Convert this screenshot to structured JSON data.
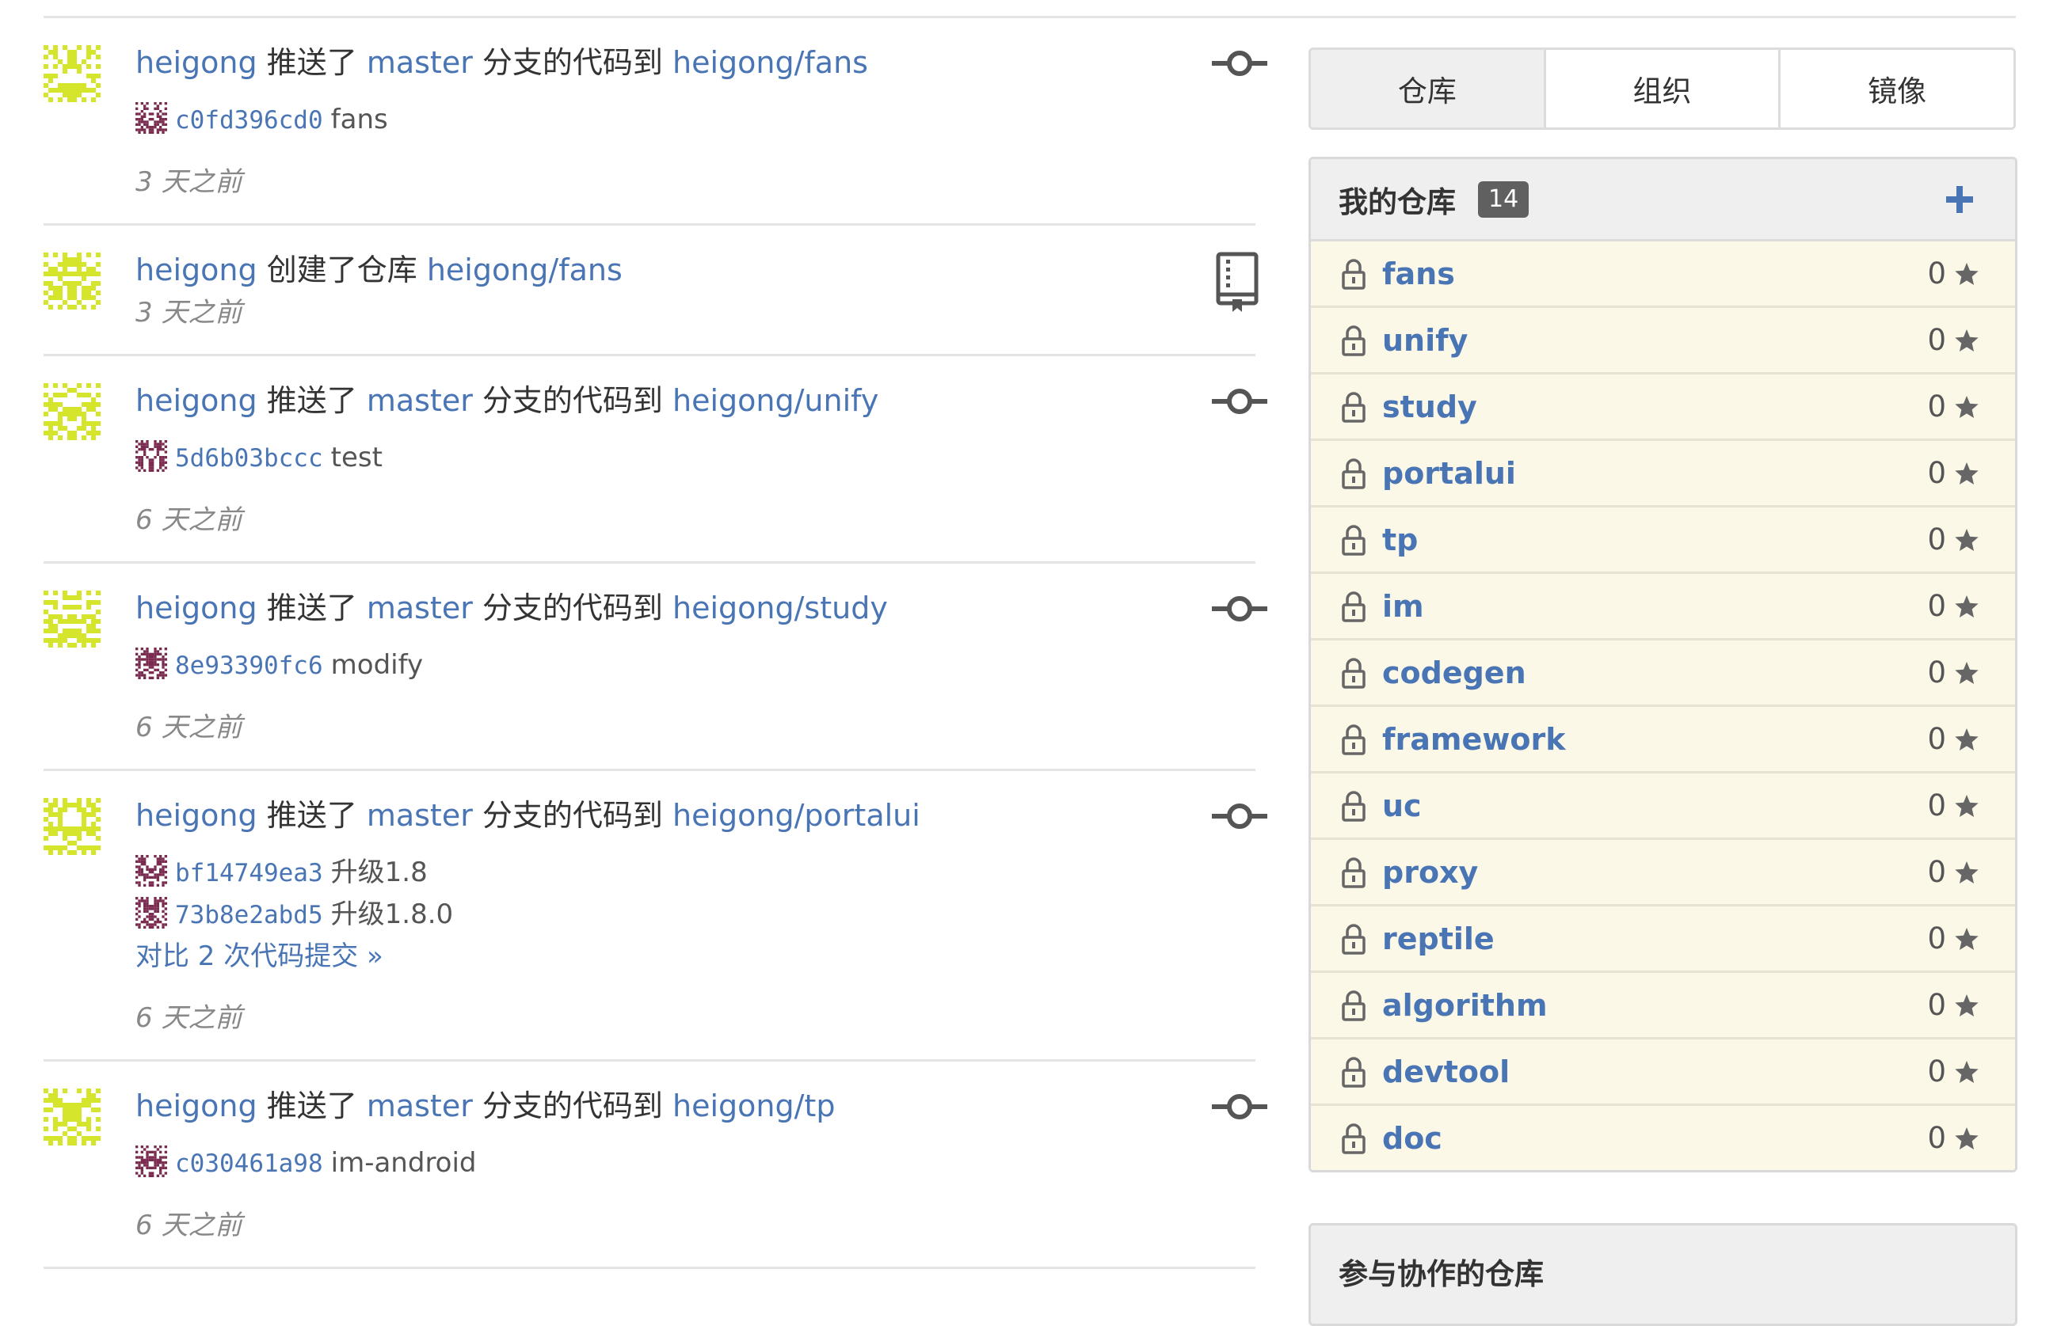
{
  "feed": [
    {
      "user": "heigong",
      "action": "推送了",
      "branch": "master",
      "mid": "分支的代码到",
      "repo": "heigong/fans",
      "icon": "commit-icon",
      "commits": [
        {
          "sha": "c0fd396cd0",
          "message": "fans"
        }
      ],
      "compare": "",
      "time": "3 天之前"
    },
    {
      "user": "heigong",
      "action": "创建了仓库",
      "branch": "",
      "mid": "",
      "repo": "heigong/fans",
      "icon": "repo-book-icon",
      "commits": [],
      "compare": "",
      "time": "3 天之前"
    },
    {
      "user": "heigong",
      "action": "推送了",
      "branch": "master",
      "mid": "分支的代码到",
      "repo": "heigong/unify",
      "icon": "commit-icon",
      "commits": [
        {
          "sha": "5d6b03bccc",
          "message": "test"
        }
      ],
      "compare": "",
      "time": "6 天之前"
    },
    {
      "user": "heigong",
      "action": "推送了",
      "branch": "master",
      "mid": "分支的代码到",
      "repo": "heigong/study",
      "icon": "commit-icon",
      "commits": [
        {
          "sha": "8e93390fc6",
          "message": "modify"
        }
      ],
      "compare": "",
      "time": "6 天之前"
    },
    {
      "user": "heigong",
      "action": "推送了",
      "branch": "master",
      "mid": "分支的代码到",
      "repo": "heigong/portalui",
      "icon": "commit-icon",
      "commits": [
        {
          "sha": "bf14749ea3",
          "message": "升级1.8"
        },
        {
          "sha": "73b8e2abd5",
          "message": "升级1.8.0"
        }
      ],
      "compare": "对比 2 次代码提交 »",
      "time": "6 天之前"
    },
    {
      "user": "heigong",
      "action": "推送了",
      "branch": "master",
      "mid": "分支的代码到",
      "repo": "heigong/tp",
      "icon": "commit-icon",
      "commits": [
        {
          "sha": "c030461a98",
          "message": "im-android"
        }
      ],
      "compare": "",
      "time": "6 天之前"
    }
  ],
  "tabs": [
    "仓库",
    "组织",
    "镜像"
  ],
  "my_repos": {
    "title": "我的仓库",
    "count": "14",
    "add_icon": "plus-icon",
    "items": [
      {
        "name": "fans",
        "stars": "0"
      },
      {
        "name": "unify",
        "stars": "0"
      },
      {
        "name": "study",
        "stars": "0"
      },
      {
        "name": "portalui",
        "stars": "0"
      },
      {
        "name": "tp",
        "stars": "0"
      },
      {
        "name": "im",
        "stars": "0"
      },
      {
        "name": "codegen",
        "stars": "0"
      },
      {
        "name": "framework",
        "stars": "0"
      },
      {
        "name": "uc",
        "stars": "0"
      },
      {
        "name": "proxy",
        "stars": "0"
      },
      {
        "name": "reptile",
        "stars": "0"
      },
      {
        "name": "algorithm",
        "stars": "0"
      },
      {
        "name": "devtool",
        "stars": "0"
      },
      {
        "name": "doc",
        "stars": "0"
      }
    ]
  },
  "collab_repos": {
    "title": "参与协作的仓库"
  },
  "colors": {
    "link": "#4a75b5",
    "avatar": "#d4e52b",
    "commit_avatar": "#7a2b4f",
    "row_bg": "#fbf8e8"
  }
}
